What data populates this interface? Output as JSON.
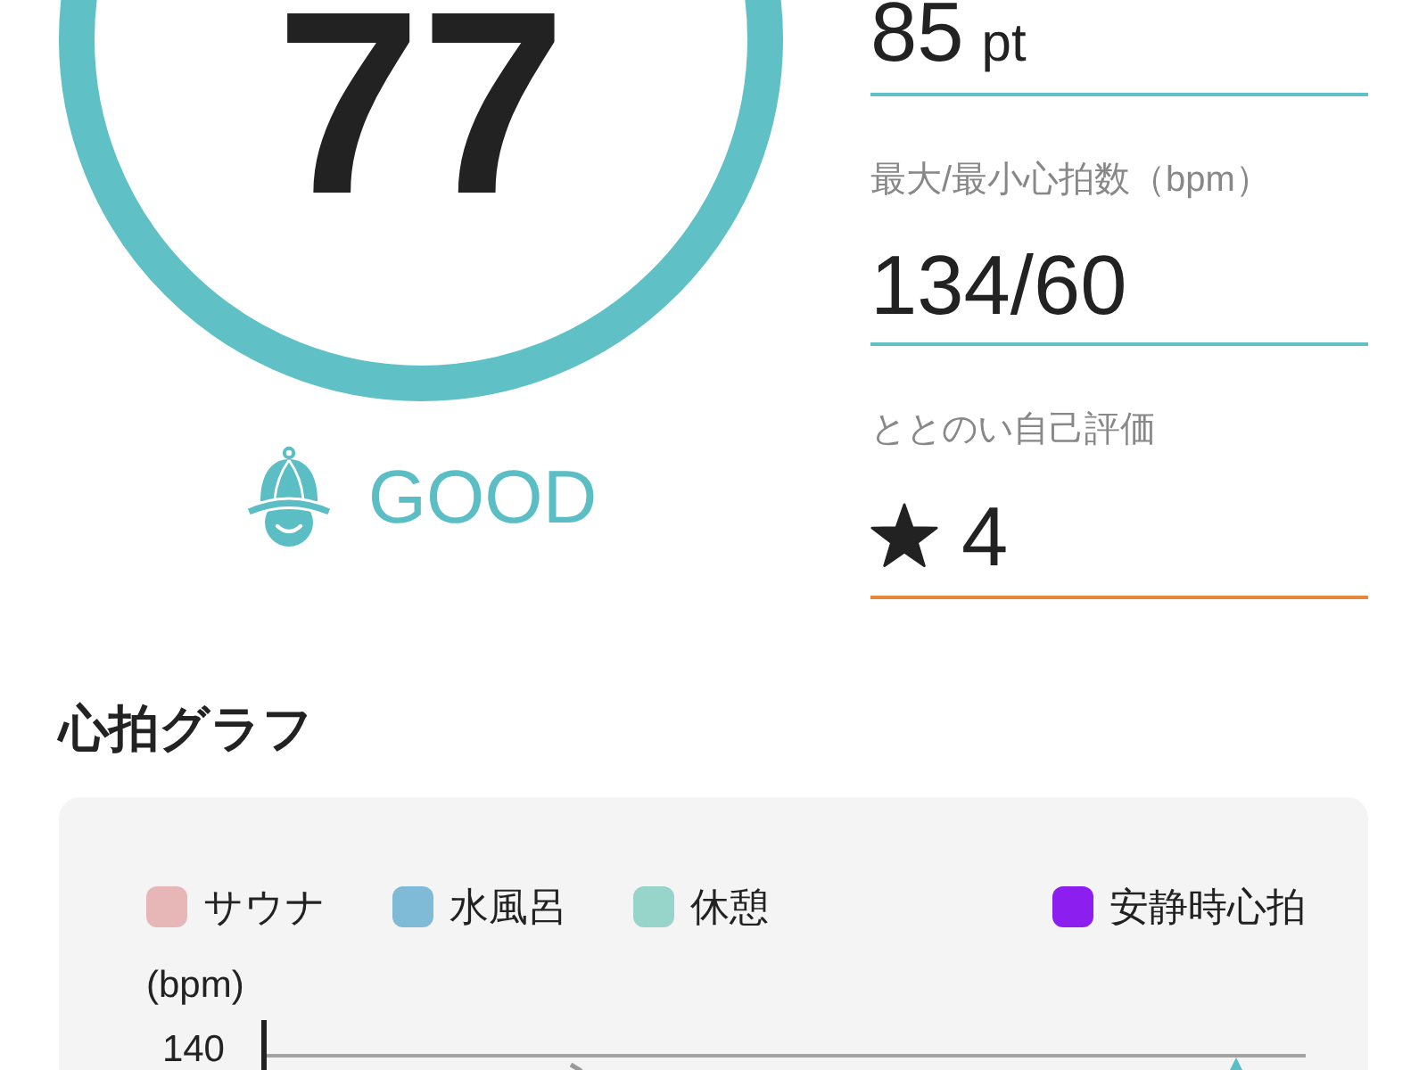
{
  "score": {
    "value": "77",
    "status": "GOOD"
  },
  "stats": [
    {
      "kind": "number",
      "value": "85",
      "unit": "pt",
      "color": "#5fc0c6"
    },
    {
      "kind": "number",
      "label": "最大/最小心拍数（bpm）",
      "value": "134/60",
      "color": "#5fc0c6"
    },
    {
      "kind": "rating",
      "label": "ととのい自己評価",
      "value": "4",
      "color": "#e8873a"
    }
  ],
  "heart_rate_graph": {
    "title": "心拍グラフ",
    "legend": [
      {
        "label": "サウナ",
        "color": "#e7b7b8",
        "kind": "zone"
      },
      {
        "label": "水風呂",
        "color": "#7fbad6",
        "kind": "zone"
      },
      {
        "label": "休憩",
        "color": "#97d5cb",
        "kind": "zone"
      },
      {
        "label": "安静時心拍",
        "color": "#8c1ff0",
        "kind": "line"
      }
    ],
    "y_unit": "(bpm)",
    "y_tick_labels": [
      "140"
    ]
  }
}
